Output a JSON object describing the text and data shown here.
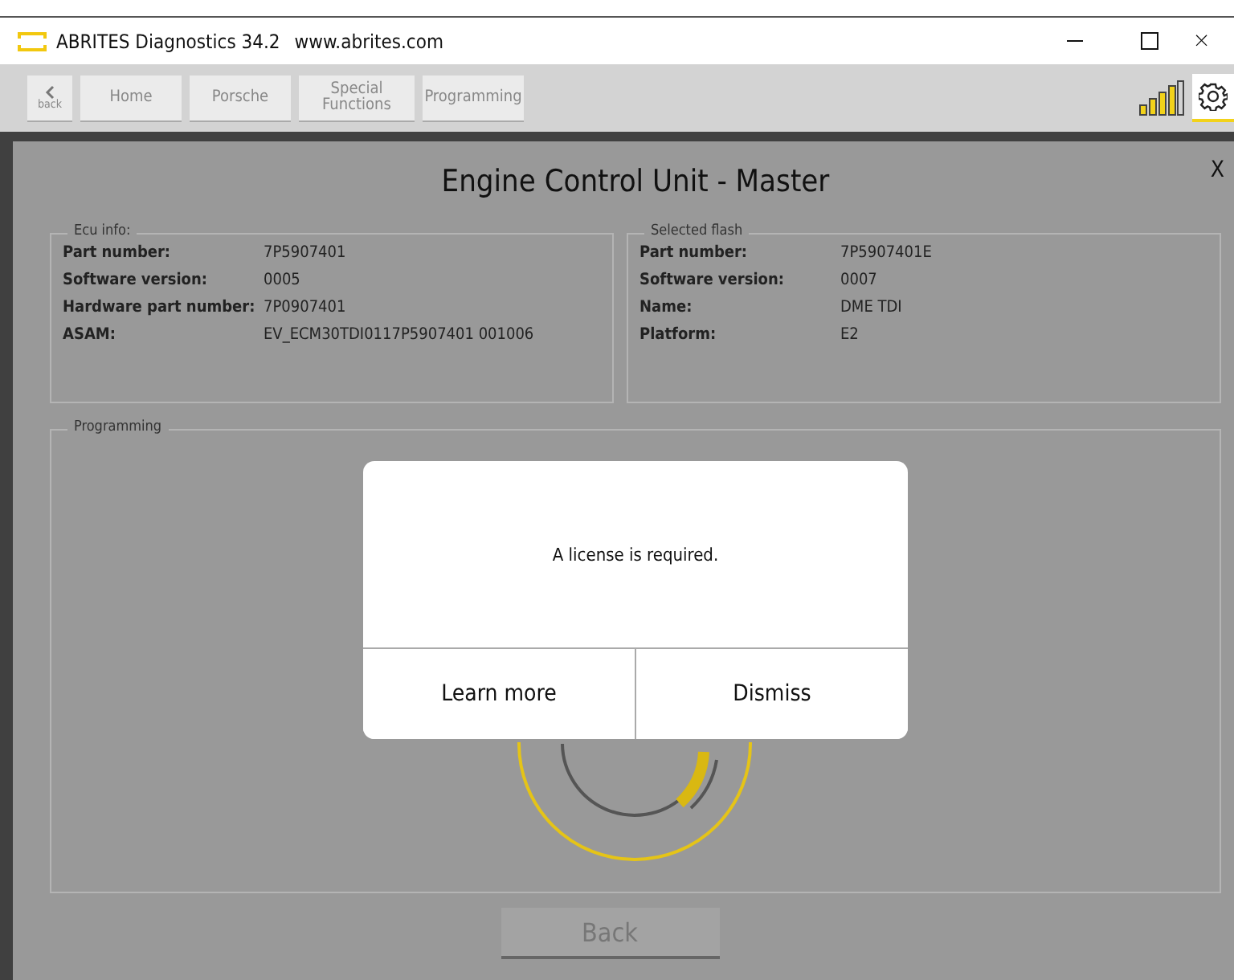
{
  "window": {
    "title": "ABRITES Diagnostics 34.2",
    "url": "www.abrites.com"
  },
  "toolbar": {
    "back_label": "back",
    "buttons": [
      "Home",
      "Porsche",
      "Special Functions",
      "Programming"
    ]
  },
  "panel": {
    "title": "Engine Control Unit - Master",
    "close": "X"
  },
  "ecu_info": {
    "legend": "Ecu info:",
    "fields": [
      {
        "label": "Part number:",
        "value": "7P5907401"
      },
      {
        "label": "Software version:",
        "value": "0005"
      },
      {
        "label": "Hardware part number:",
        "value": "7P0907401"
      },
      {
        "label": "ASAM:",
        "value": "EV_ECM30TDI0117P5907401 001006"
      }
    ]
  },
  "selected_flash": {
    "legend": "Selected flash",
    "fields": [
      {
        "label": "Part number:",
        "value": "7P5907401E"
      },
      {
        "label": "Software version:",
        "value": "0007"
      },
      {
        "label": "Name:",
        "value": "DME TDI"
      },
      {
        "label": "Platform:",
        "value": "E2"
      }
    ]
  },
  "programming": {
    "legend": "Programming"
  },
  "back_button": {
    "label": "Back",
    "disabled": true
  },
  "dialog": {
    "message": "A license is required.",
    "buttons": [
      "Learn more",
      "Dismiss"
    ]
  }
}
